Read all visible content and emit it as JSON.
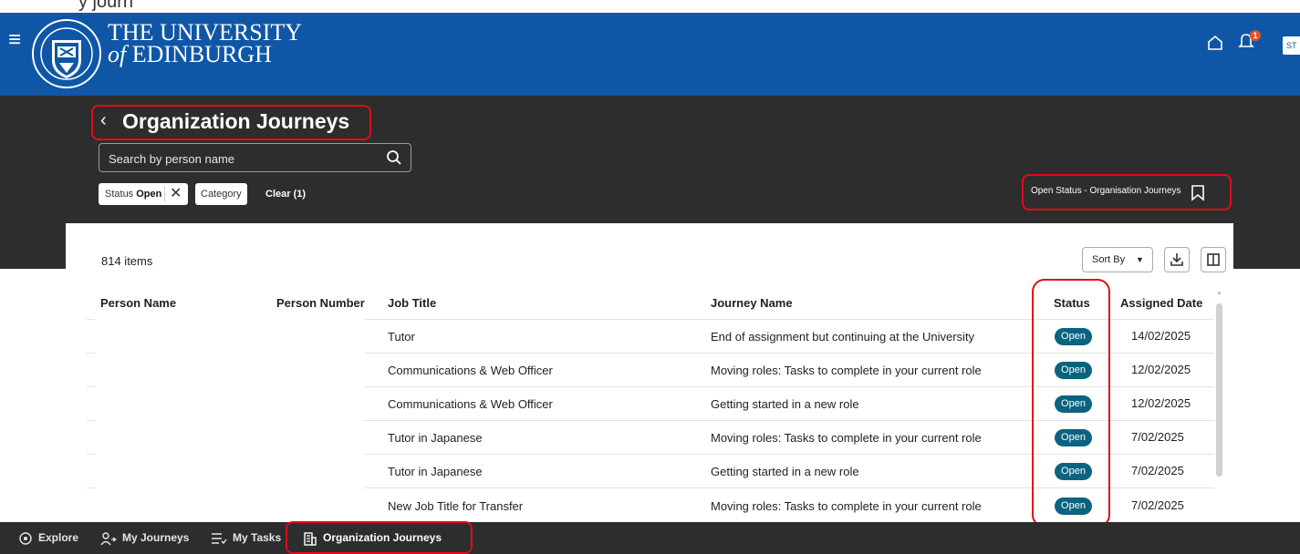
{
  "top_strip_text": "y journ",
  "header": {
    "university_line1": "THE UNIVERSITY",
    "university_line2_prefix": "of",
    "university_line2": "EDINBURGH",
    "notification_count": "1",
    "avatar_initials": "ST"
  },
  "page": {
    "title": "Organization Journeys",
    "search_placeholder": "Search by person name",
    "filters": {
      "status_label": "Status",
      "status_value": "Open",
      "category_label": "Category",
      "clear_label": "Clear (1)"
    },
    "saved_search_label": "Open Status - Organisation Journeys"
  },
  "table": {
    "items_count": "814 items",
    "sort_label": "Sort By",
    "columns": [
      "Person Name",
      "Person Number",
      "Job Title",
      "Journey Name",
      "Status",
      "Assigned Date"
    ],
    "rows": [
      {
        "job_title": "Tutor",
        "journey_name": "End of assignment but continuing at the University",
        "status": "Open",
        "assigned_date": "14/02/2025"
      },
      {
        "job_title": "Communications & Web Officer",
        "journey_name": "Moving roles: Tasks to complete in your current role",
        "status": "Open",
        "assigned_date": "12/02/2025"
      },
      {
        "job_title": "Communications & Web Officer",
        "journey_name": "Getting started in a new role",
        "status": "Open",
        "assigned_date": "12/02/2025"
      },
      {
        "job_title": "Tutor in Japanese",
        "journey_name": "Moving roles: Tasks to complete in your current role",
        "status": "Open",
        "assigned_date": "7/02/2025"
      },
      {
        "job_title": "Tutor in Japanese",
        "journey_name": "Getting started in a new role",
        "status": "Open",
        "assigned_date": "7/02/2025"
      },
      {
        "job_title": "New Job Title for Transfer",
        "journey_name": "Moving roles: Tasks to complete in your current role",
        "status": "Open",
        "assigned_date": "7/02/2025"
      }
    ]
  },
  "bottom_nav": {
    "items": [
      {
        "label": "Explore",
        "icon": "eye-icon"
      },
      {
        "label": "My Journeys",
        "icon": "person-route-icon"
      },
      {
        "label": "My Tasks",
        "icon": "task-list-icon"
      },
      {
        "label": "Organization Journeys",
        "icon": "building-icon",
        "active": true
      }
    ]
  },
  "colors": {
    "brand_blue": "#0f57a6",
    "dark_band": "#2d2d2d",
    "status_badge": "#0b6380",
    "annotation_red": "#e30b17"
  }
}
